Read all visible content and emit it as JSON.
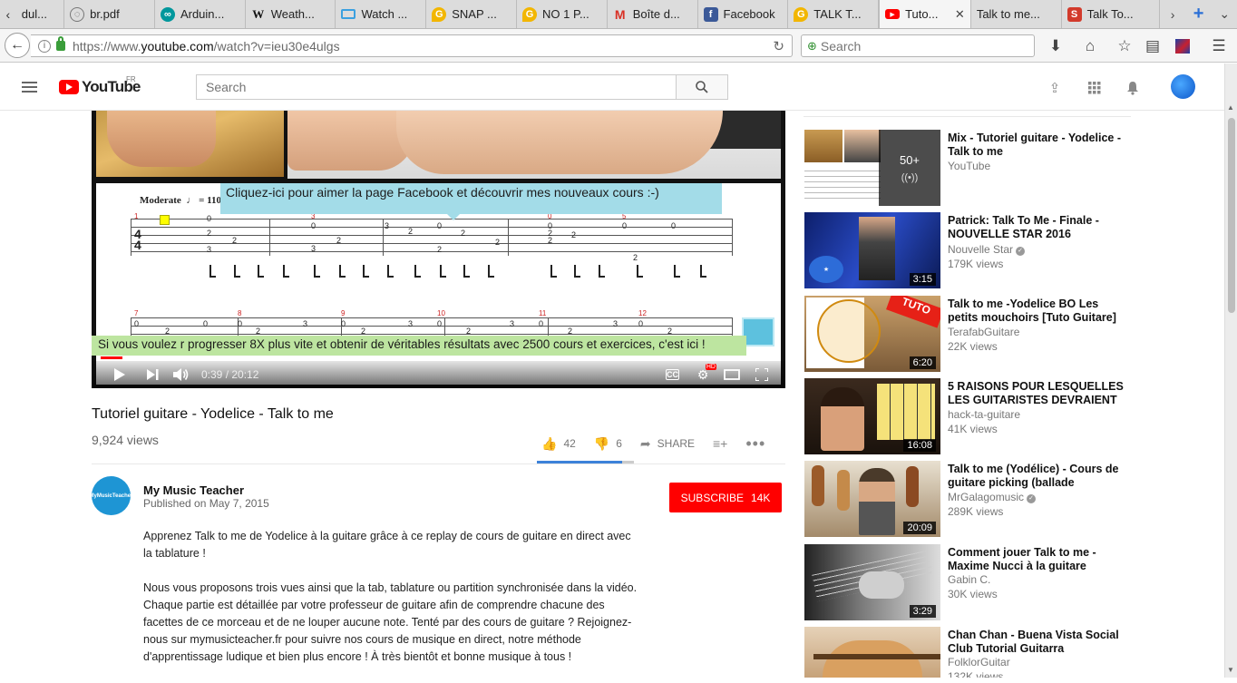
{
  "browser": {
    "tabs": [
      {
        "label": "dul...",
        "icon": "cut-off-tab-icon"
      },
      {
        "label": "br.pdf",
        "icon": "pdf-icon"
      },
      {
        "label": "Arduin...",
        "icon": "arduino-icon"
      },
      {
        "label": "Weath...",
        "icon": "wikipedia-icon"
      },
      {
        "label": "Watch ...",
        "icon": "tv-icon"
      },
      {
        "label": "SNAP ...",
        "icon": "badge-icon"
      },
      {
        "label": "NO 1 P...",
        "icon": "badge-icon"
      },
      {
        "label": "Boîte d...",
        "icon": "gmail-icon"
      },
      {
        "label": "Facebook",
        "icon": "facebook-icon"
      },
      {
        "label": "TALK T...",
        "icon": "badge-icon"
      },
      {
        "label": "Tuto...",
        "icon": "youtube-icon",
        "active": true
      },
      {
        "label": "Talk to me...",
        "icon": "none"
      },
      {
        "label": "Talk To...",
        "icon": "s-icon"
      }
    ],
    "url_prefix": "https://www.",
    "url_domain": "youtube.com",
    "url_path": "/watch?v=ieu30e4ulgs",
    "search_placeholder": "Search"
  },
  "youtube": {
    "logo_text": "YouTube",
    "country": "FR",
    "search_placeholder": "Search"
  },
  "player": {
    "tempo_label": "Moderate",
    "tempo_value": "= 110",
    "annotation_facebook": "Cliquez-ici pour aimer la page Facebook et découvrir mes nouveaux cours :-)",
    "annotation_course": "Si vous voulez r progresser 8X plus vite et obtenir de véritables résultats avec 2500 cours et exercices, c'est ici !",
    "time_current": "0:39",
    "time_sep": " / ",
    "time_total": "20:12",
    "progress_played": 0.032,
    "progress_buffered": 0.12,
    "cc_label": "CC",
    "hd_label": "HD"
  },
  "video": {
    "title": "Tutoriel guitare - Yodelice - Talk to me",
    "views": "9,924 views",
    "likes": "42",
    "dislikes": "6",
    "share_label": "SHARE",
    "like_ratio": 0.875
  },
  "channel": {
    "name": "My Music Teacher",
    "avatar_text": "MyMusicTeacher",
    "published": "Published on May 7, 2015",
    "subscribe_label": "SUBSCRIBE",
    "subscriber_count": "14K"
  },
  "description": [
    "Apprenez Talk to me de Yodelice à la guitare grâce à ce replay de cours de guitare en direct avec la tablature !",
    "Nous vous proposons trois vues ainsi que la tab, tablature ou partition synchronisée dans la vidéo. Chaque partie est détaillée par votre professeur de guitare afin de comprendre chacune des facettes de ce morceau et de ne louper aucune note. Tenté par des cours de guitare ? Rejoignez-nous sur mymusicteacher.fr pour suivre nos cours de musique en direct, notre méthode d'apprentissage ludique et bien plus encore ! À très bientôt et bonne musique à tous !"
  ],
  "recommendations": [
    {
      "title": "Mix - Tutoriel guitare - Yodelice - Talk to me",
      "channel": "YouTube",
      "views": "",
      "duration": "",
      "mix_count": "50+",
      "verified": false
    },
    {
      "title": "Patrick: Talk To Me - Finale - NOUVELLE STAR 2016",
      "channel": "Nouvelle Star",
      "views": "179K views",
      "duration": "3:15",
      "verified": true
    },
    {
      "title": "Talk to me -Yodelice BO Les petits mouchoirs [Tuto Guitare]",
      "channel": "TerafabGuitare",
      "views": "22K views",
      "duration": "6:20",
      "verified": false
    },
    {
      "title": "5 RAISONS POUR LESQUELLES LES GUITARISTES DEVRAIENT",
      "channel": "hack-ta-guitare",
      "views": "41K views",
      "duration": "16:08",
      "verified": false
    },
    {
      "title": "Talk to me (Yodélice) - Cours de guitare picking (ballade",
      "channel": "MrGalagomusic",
      "views": "289K views",
      "duration": "20:09",
      "verified": true
    },
    {
      "title": "Comment jouer Talk to me - Maxime Nucci à la guitare",
      "channel": "Gabin C.",
      "views": "30K views",
      "duration": "3:29",
      "verified": false
    },
    {
      "title": "Chan Chan - Buena Vista Social Club Tutorial Guitarra",
      "channel": "FolklorGuitar",
      "views": "132K views",
      "duration": "",
      "verified": false
    }
  ]
}
